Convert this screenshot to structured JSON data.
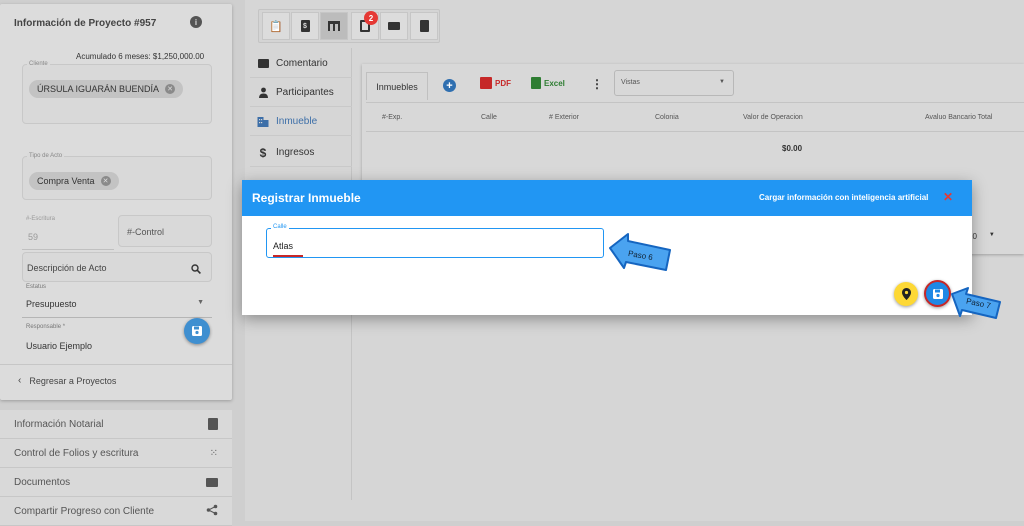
{
  "project": {
    "title": "Información de Proyecto #957",
    "accumulated": "Acumulado 6 meses: $1,250,000.00",
    "client_label": "Cliente",
    "client_chip": "ÚRSULA IGUARÁN BUENDÍA",
    "act_type_label": "Tipo de Acto",
    "act_type_chip": "Compra Venta",
    "escritura_label": "#-Escritura",
    "escritura_value": "59",
    "control_placeholder": "#-Control",
    "descripcion_placeholder": "Descripción de Acto",
    "estatus_label": "Estatus",
    "estatus_value": "Presupuesto",
    "responsable_label": "Responsable *",
    "responsable_value": "Usuario Ejemplo",
    "back_label": "Regresar a Proyectos"
  },
  "side_nav": [
    {
      "label": "Información Notarial",
      "icon": "book-icon"
    },
    {
      "label": "Control de Folios y escritura",
      "icon": "grid-dots-icon"
    },
    {
      "label": "Documentos",
      "icon": "folder-icon"
    },
    {
      "label": "Compartir Progreso con Cliente",
      "icon": "share-icon"
    }
  ],
  "toolbar": {
    "badge_count": "2",
    "icons": [
      "clipboard-clock-icon",
      "receipt-dollar-icon",
      "table-icon",
      "copy-icon",
      "print-icon",
      "document-icon"
    ]
  },
  "menu": [
    {
      "label": "Comentario",
      "icon": "comment-icon"
    },
    {
      "label": "Participantes",
      "icon": "person-icon"
    },
    {
      "label": "Inmueble",
      "icon": "building-icon",
      "active": true
    },
    {
      "label": "Ingresos",
      "icon": "dollar-icon"
    }
  ],
  "inmuebles": {
    "tab_label": "Inmuebles",
    "pdf_label": "PDF",
    "excel_label": "Excel",
    "views_placeholder": "Vistas",
    "columns": [
      "#-Exp.",
      "Calle",
      "# Exterior",
      "Colonia",
      "Valor de Operacion",
      "Avaluo Bancario Total"
    ],
    "total": "$0.00",
    "page_size": "20"
  },
  "dialog": {
    "title": "Registrar Inmueble",
    "ai_link": "Cargar información con inteligencia artificial",
    "calle_label": "Calle",
    "calle_value": "Atlas"
  },
  "annotations": {
    "step6": "Paso 6",
    "step7": "Paso 7"
  },
  "colors": {
    "dialog_header": "#2196f3",
    "close_red": "#e53935",
    "location_yellow": "#fdd835",
    "save_blue": "#1e88e5",
    "arrow_blue": "#1565c0",
    "arrow_fill": "#4aa3f0",
    "badge_red": "#e53935",
    "pdf_red": "#c62828",
    "excel_green": "#2e7d32"
  }
}
